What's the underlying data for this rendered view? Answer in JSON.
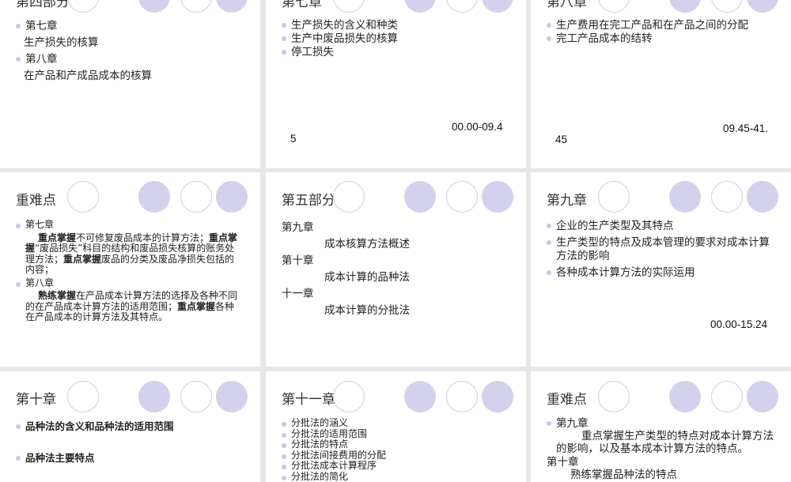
{
  "slides": [
    {
      "title": "第四部分",
      "lines": [
        {
          "type": "bullet",
          "text": "第七章"
        },
        {
          "type": "plain",
          "text": "生产损失的核算"
        },
        {
          "type": "bullet",
          "text": "第八章"
        },
        {
          "type": "plain",
          "text": "在产品和产成品成本的核算"
        }
      ]
    },
    {
      "title": "第七章",
      "lines": [
        {
          "type": "bullet",
          "text": "生产损失的含义和种类"
        },
        {
          "type": "bullet",
          "text": "生产中废品损失的核算"
        },
        {
          "type": "bullet",
          "text": "停工损失"
        }
      ],
      "time_a": "00.00-09.4",
      "time_b": "5"
    },
    {
      "title": "第八章",
      "lines": [
        {
          "type": "bullet",
          "text": "生产费用在完工产品和在产品之间的分配"
        },
        {
          "type": "bullet",
          "text": "完工产品成本的结转"
        }
      ],
      "time_a": "09.45-41.",
      "time_b": "45"
    },
    {
      "title": "重难点",
      "ch7": "第七章",
      "ch7_b1": "重点掌握",
      "ch7_t1": "不可修复废品成本的计算方法；",
      "ch7_b2": "重点掌握",
      "ch7_t2": "“废品损失”科目的结构和废品损失核算的账务处理方法；",
      "ch7_b3": "重点掌握",
      "ch7_t3": "废品的分类及废品净损失包括的内容；",
      "ch8": "第八章",
      "ch8_b1": "熟练掌握",
      "ch8_t1": "在产品成本计算方法的选择及各种不同的在产品成本计算方法的适用范围；",
      "ch8_b2": "重点掌握",
      "ch8_t2": "各种在产品成本的计算方法及其特点。"
    },
    {
      "title": "第五部分",
      "lines": [
        {
          "type": "plain",
          "text": "第九章"
        },
        {
          "type": "deep",
          "text": "成本核算方法概述"
        },
        {
          "type": "plain",
          "text": "第十章"
        },
        {
          "type": "deep",
          "text": "成本计算的品种法"
        },
        {
          "type": "plain",
          "text": "十一章"
        },
        {
          "type": "deep",
          "text": "成本计算的分批法"
        }
      ]
    },
    {
      "title": "第九章",
      "lines": [
        {
          "type": "bullet",
          "text": "企业的生产类型及其特点"
        },
        {
          "type": "bullet",
          "text": "生产类型的特点及成本管理的要求对成本计算方法的影响"
        },
        {
          "type": "bullet",
          "text": "各种成本计算方法的实际运用"
        }
      ],
      "time_a": "00.00-15.24"
    },
    {
      "title": "第十章",
      "lines": [
        {
          "type": "bullet",
          "text": "品种法的含义和品种法的适用范围"
        },
        {
          "type": "bullet",
          "text": "品种法主要特点"
        }
      ]
    },
    {
      "title": "第十一章",
      "lines": [
        {
          "type": "bullet",
          "text": "分批法的涵义"
        },
        {
          "type": "bullet",
          "text": "分批法的适用范围"
        },
        {
          "type": "bullet",
          "text": "分批法的特点"
        },
        {
          "type": "bullet",
          "text": "分批法间接费用的分配"
        },
        {
          "type": "bullet",
          "text": "分批法成本计算程序"
        },
        {
          "type": "bullet",
          "text": "分批法的简化"
        }
      ]
    },
    {
      "title": "重难点",
      "ch9": "第九章",
      "ch9_text": "重点掌握生产类型的特点对成本计算方法的影响，以及基本成本计算方法的特点。",
      "ch10": "第十章",
      "ch10_text": "熟练掌握品种法的特点"
    }
  ],
  "colors": {
    "circle_fill": "#d3d1eb",
    "circle_outline": "#cfcde2",
    "bullet": "#c9c7e6",
    "gap": "#e6e6e6"
  }
}
